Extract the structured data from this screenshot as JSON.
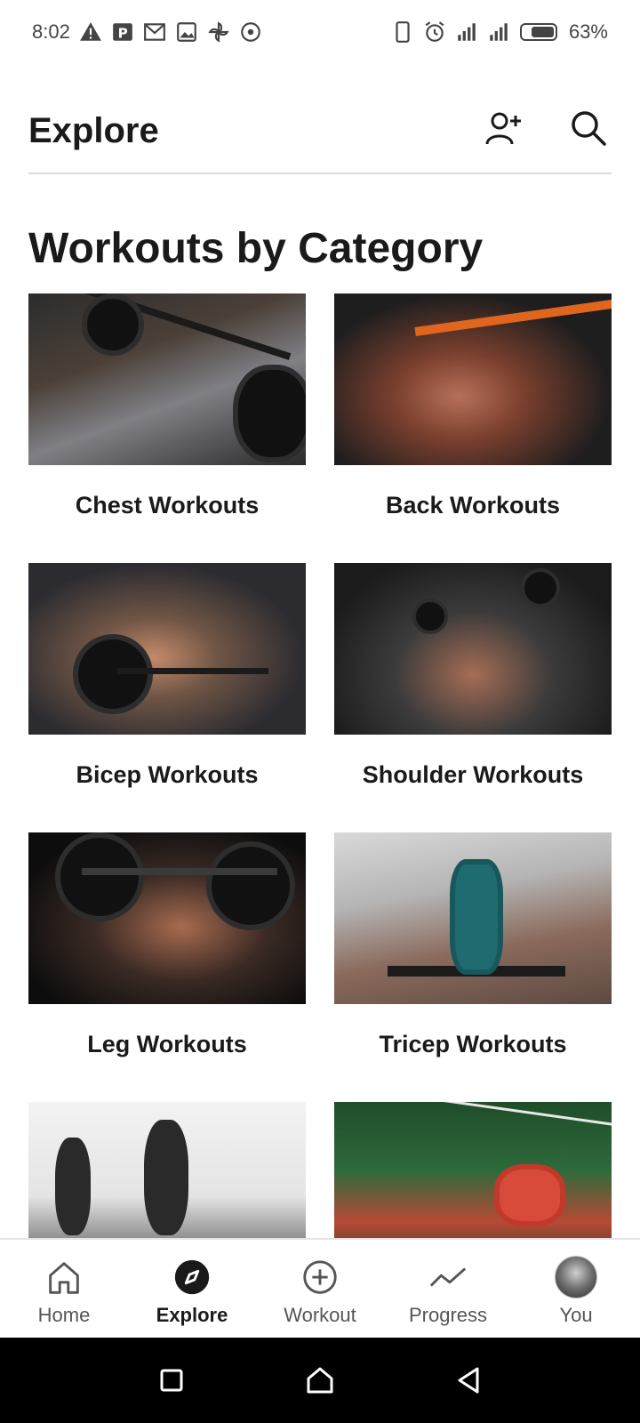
{
  "status_bar": {
    "time": "8:02",
    "battery_percent": "63%",
    "left_icons": [
      "warning-icon",
      "parking-icon",
      "gmail-icon",
      "image-icon",
      "pinwheel-icon",
      "target-icon"
    ],
    "right_icons": [
      "phone-icon",
      "alarm-icon",
      "signal-icon",
      "signal-icon",
      "battery-icon"
    ]
  },
  "header": {
    "title": "Explore",
    "actions": [
      "add-person-icon",
      "search-icon"
    ]
  },
  "section": {
    "title": "Workouts by Category"
  },
  "categories": [
    {
      "label": "Chest Workouts",
      "photo": "chest"
    },
    {
      "label": "Back Workouts",
      "photo": "back"
    },
    {
      "label": "Bicep Workouts",
      "photo": "bicep"
    },
    {
      "label": "Shoulder Workouts",
      "photo": "shoulder"
    },
    {
      "label": "Leg Workouts",
      "photo": "leg"
    },
    {
      "label": "Tricep Workouts",
      "photo": "tricep"
    },
    {
      "label": "",
      "photo": "lunge"
    },
    {
      "label": "",
      "photo": "abs"
    }
  ],
  "bottom_nav": {
    "items": [
      {
        "label": "Home",
        "icon": "home-icon",
        "active": false
      },
      {
        "label": "Explore",
        "icon": "compass-icon",
        "active": true
      },
      {
        "label": "Workout",
        "icon": "plus-circle-icon",
        "active": false
      },
      {
        "label": "Progress",
        "icon": "trend-icon",
        "active": false
      },
      {
        "label": "You",
        "icon": "avatar",
        "active": false
      }
    ]
  },
  "system_nav": {
    "buttons": [
      "recents-icon",
      "home-icon",
      "back-icon"
    ]
  }
}
